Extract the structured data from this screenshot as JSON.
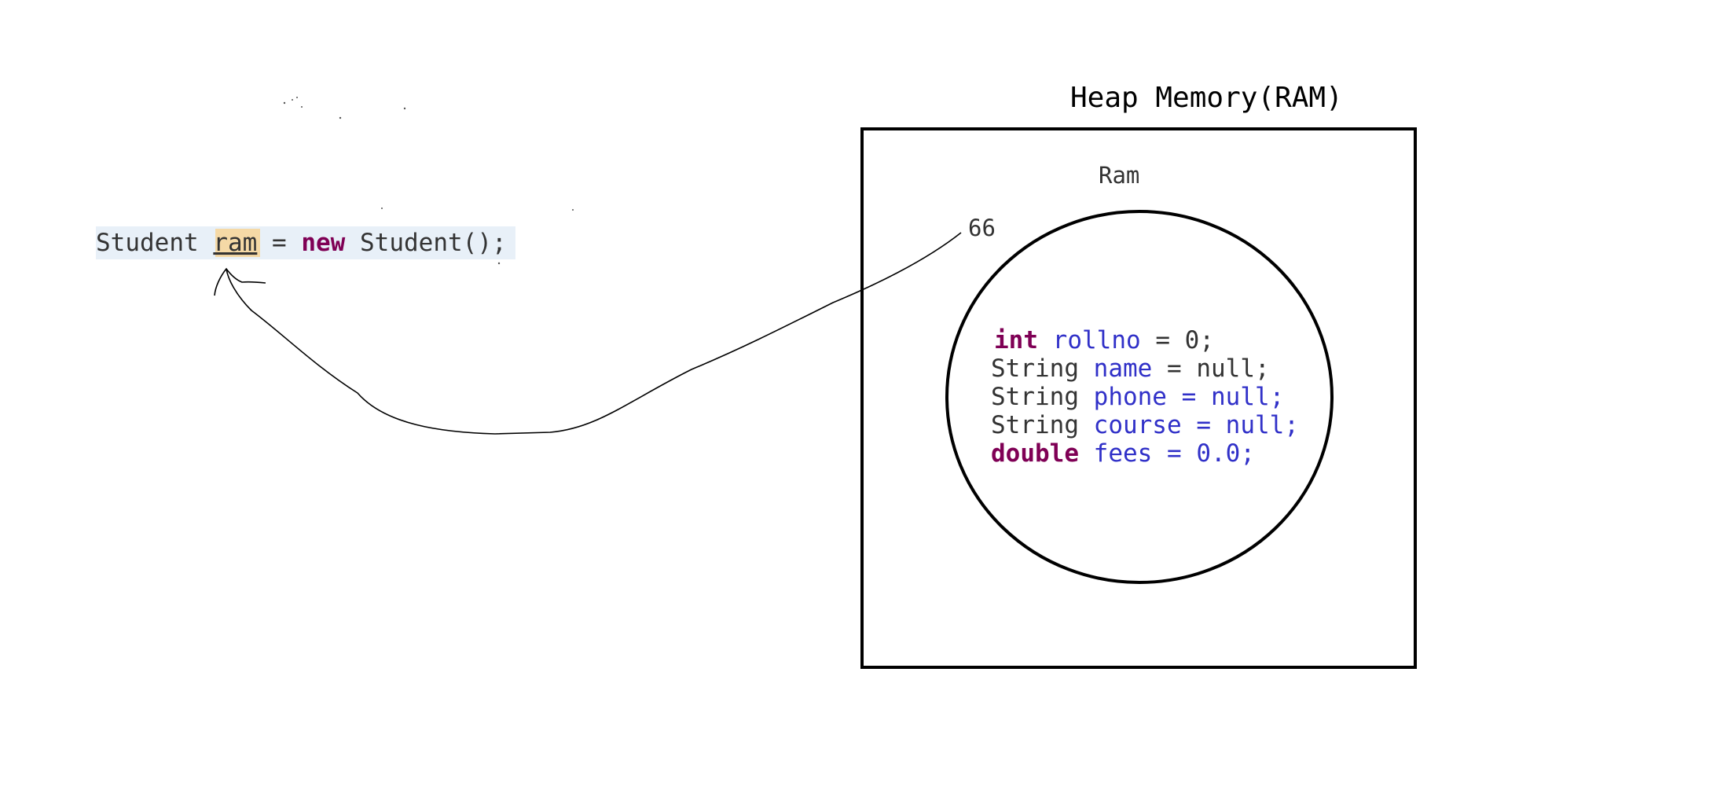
{
  "statement": {
    "type_name": "Student",
    "variable": "ram",
    "operator": "=",
    "keyword": "new",
    "constructor_call": "Student();"
  },
  "heap": {
    "title": "Heap Memory(RAM)",
    "object_name": "Ram",
    "address": "66",
    "fields": [
      {
        "type": "int",
        "type_is_keyword": true,
        "name": "rollno",
        "assign": "=",
        "value": "0;"
      },
      {
        "type": "String",
        "type_is_keyword": false,
        "name": "name",
        "assign": "=",
        "value": "null;"
      },
      {
        "type": "String",
        "type_is_keyword": false,
        "name": "phone",
        "assign": "=",
        "value": "null;"
      },
      {
        "type": "String",
        "type_is_keyword": false,
        "name": "course",
        "assign": "=",
        "value": "null;"
      },
      {
        "type": "double",
        "type_is_keyword": true,
        "name": "fees",
        "assign": "=",
        "value": "0.0;"
      }
    ]
  },
  "colors": {
    "keyword": "#7f0055",
    "field": "#3030c8",
    "plain": "#333333",
    "line_highlight": "#e8f0f8",
    "variable_highlight": "#f5d9a6",
    "stroke": "#000000"
  }
}
